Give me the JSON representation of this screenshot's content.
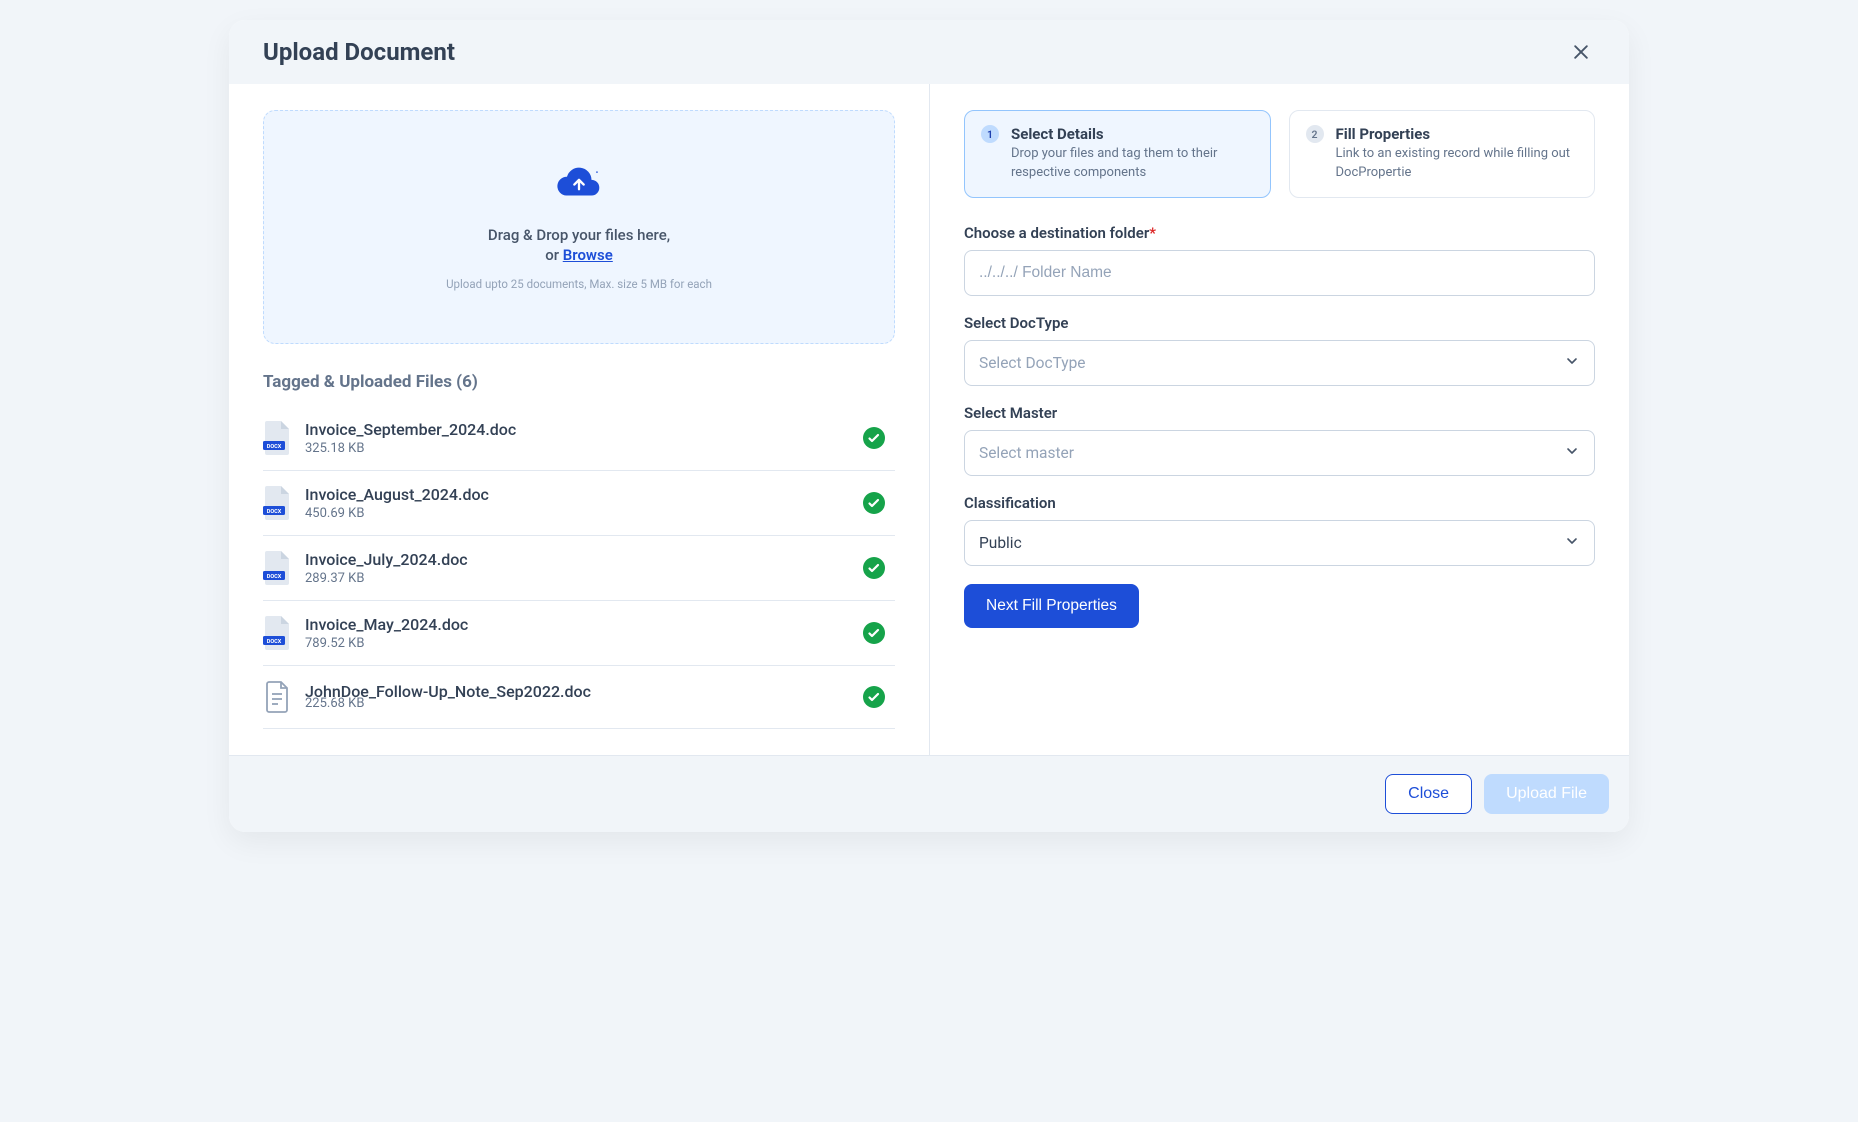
{
  "header": {
    "title": "Upload Document"
  },
  "dropzone": {
    "text1": "Drag & Drop your files here,",
    "text2": "or ",
    "browse": "Browse",
    "hint": "Upload upto 25 documents, Max. size 5 MB for each"
  },
  "filesSectionTitle": "Tagged & Uploaded Files (6)",
  "files": [
    {
      "name": "Invoice_September_2024.doc",
      "size": "325.18 KB",
      "type": "docx"
    },
    {
      "name": "Invoice_August_2024.doc",
      "size": "450.69 KB",
      "type": "docx"
    },
    {
      "name": "Invoice_July_2024.doc",
      "size": "289.37 KB",
      "type": "docx"
    },
    {
      "name": "Invoice_May_2024.doc",
      "size": "789.52 KB",
      "type": "docx"
    },
    {
      "name": "JohnDoe_Follow-Up_Note_Sep2022.doc",
      "size": "225.68 KB",
      "type": "doc"
    }
  ],
  "steps": [
    {
      "num": "1",
      "title": "Select Details",
      "desc": "Drop your files and tag them to their respective components"
    },
    {
      "num": "2",
      "title": "Fill Properties",
      "desc": "Link to an existing record while filling out DocPropertie"
    }
  ],
  "form": {
    "folder": {
      "label": "Choose a destination folder",
      "required": "*",
      "placeholder": "../../../ Folder Name"
    },
    "doctype": {
      "label": "Select DocType",
      "placeholder": "Select DocType"
    },
    "master": {
      "label": "Select Master",
      "placeholder": "Select master"
    },
    "classification": {
      "label": "Classification",
      "value": "Public"
    },
    "nextButton": "Next Fill Properties"
  },
  "footer": {
    "close": "Close",
    "upload": "Upload File"
  }
}
